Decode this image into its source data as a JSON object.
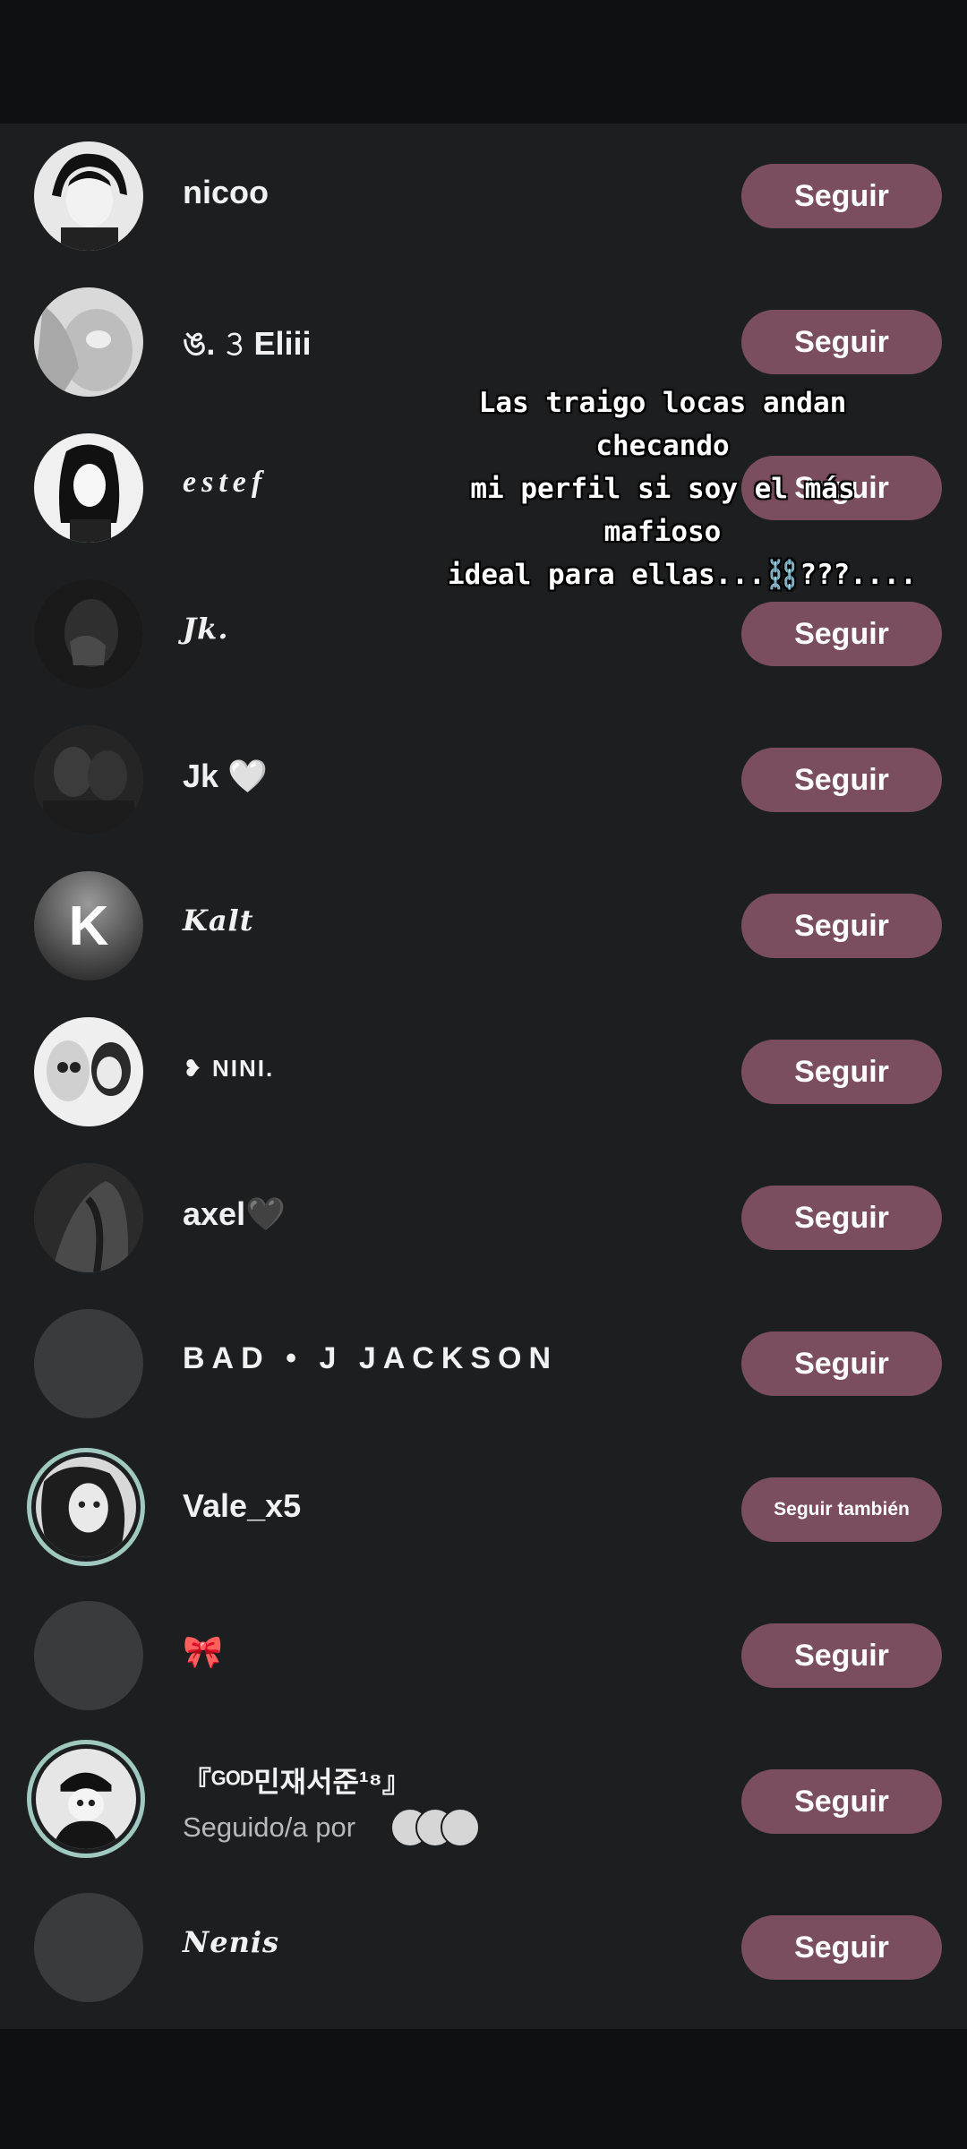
{
  "accounts": [
    {
      "username": "nicoo",
      "button": "Seguir"
    },
    {
      "username": "ঙ. 𝟹 Eliii",
      "button": "Seguir"
    },
    {
      "username": "estef",
      "button": "Seguir"
    },
    {
      "username": "Jk.",
      "button": "Seguir"
    },
    {
      "username": "Jk",
      "emoji": "🤍",
      "button": "Seguir"
    },
    {
      "username": "Kalt",
      "avatar_letter": "K",
      "button": "Seguir"
    },
    {
      "username": "❥  NINI.",
      "button": "Seguir"
    },
    {
      "username": "axel",
      "emoji": "🖤",
      "button": "Seguir"
    },
    {
      "username": "BAD • J JACKSON",
      "button": "Seguir"
    },
    {
      "username": "Vale_x5",
      "button": "Seguir también"
    },
    {
      "username": "🎀",
      "button": "Seguir"
    },
    {
      "username": "『ᴳᴼᴰ민재서준¹⁸』",
      "subtitle": "Seguido/a por",
      "button": "Seguir"
    },
    {
      "username": "Nenis",
      "button": "Seguir"
    }
  ],
  "overlay": {
    "lines": [
      "Las traigo locas andan",
      "checando",
      "mi perfil si soy el más",
      "mafioso",
      "ideal para ellas...⛓️???...."
    ]
  },
  "colors": {
    "background": "#1c1e20",
    "follow_button": "#7b4e5f",
    "story_ring": "#9fc9bf"
  }
}
